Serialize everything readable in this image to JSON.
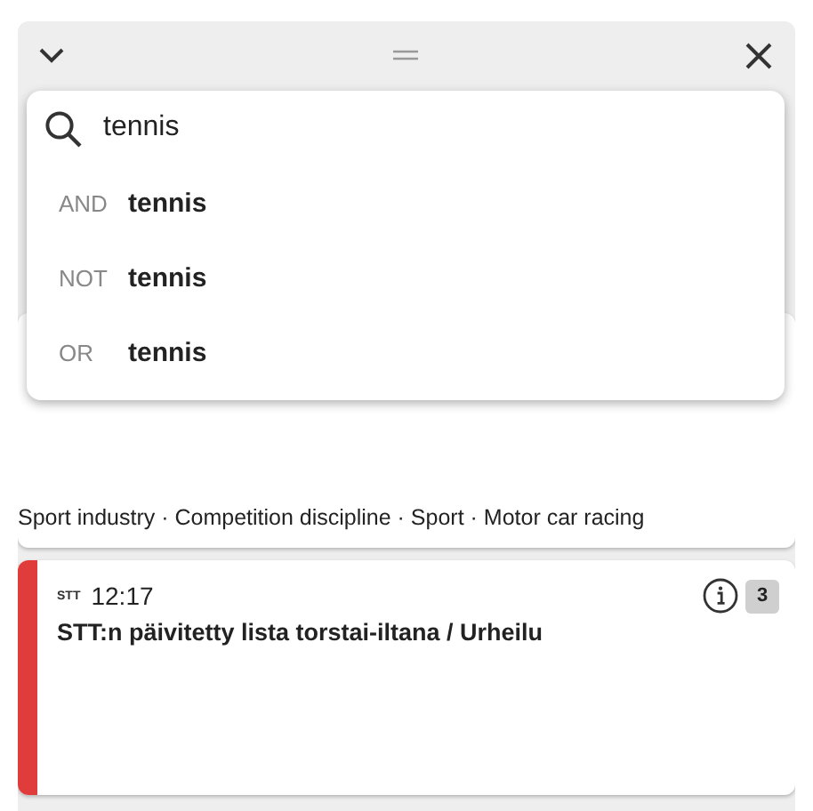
{
  "search": {
    "value": "tennis",
    "suggestions": [
      {
        "operator": "AND",
        "term": "tennis"
      },
      {
        "operator": "NOT",
        "term": "tennis"
      },
      {
        "operator": "OR",
        "term": "tennis"
      }
    ]
  },
  "cards": [
    {
      "tags": "Sport industry · Competition discipline · Sport · Motor car racing"
    },
    {
      "color": "#e03c3c",
      "source": "STT",
      "time": "12:17",
      "title": "STT:n päivitetty lista torstai-iltana / Urheilu",
      "count": "3"
    }
  ]
}
